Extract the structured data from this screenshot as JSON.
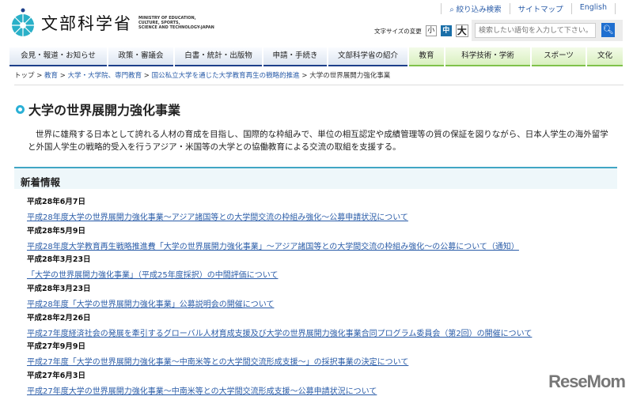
{
  "header": {
    "top_links": [
      "絞り込み検索",
      "サイトマップ",
      "English"
    ],
    "logo_name": "文部科学省",
    "logo_en": [
      "MINISTRY OF EDUCATION,",
      "CULTURE, SPORTS,",
      "SCIENCE AND TECHNOLOGY-JAPAN"
    ],
    "font_size_label": "文字サイズの変更",
    "font_sizes": [
      "小",
      "中",
      "大"
    ],
    "search_placeholder": "検索したい語句を入力して下さい。"
  },
  "nav": [
    "会見・報道・お知らせ",
    "政策・審議会",
    "白書・統計・出版物",
    "申請・手続き",
    "文部科学省の紹介",
    "教育",
    "科学技術・学術",
    "スポーツ",
    "文化"
  ],
  "breadcrumb": [
    "トップ",
    "教育",
    "大学・大学院、専門教育",
    "国公私立大学を通じた大学教育再生の戦略的推進",
    "大学の世界展開力強化事業"
  ],
  "page": {
    "title": "大学の世界展開力強化事業",
    "lead": "世界に雄飛する日本として誇れる人材の育成を目指し、国際的な枠組みで、単位の相互認定や成績管理等の質の保証を図りながら、日本人学生の海外留学と外国人学生の戦略的受入を行うアジア・米国等の大学との協働教育による交流の取組を支援する。",
    "news_heading": "新着情報",
    "news": [
      {
        "date": "平成28年6月7日",
        "title": "平成28年度大学の世界展開力強化事業～アジア諸国等との大学間交流の枠組み強化～公募申請状況について"
      },
      {
        "date": "平成28年5月9日",
        "title": "平成28年度大学教育再生戦略推進費「大学の世界展開力強化事業」～アジア諸国等との大学間交流の枠組み強化～の公募について（通知）"
      },
      {
        "date": "平成28年3月23日",
        "title": "「大学の世界展開力強化事業」（平成25年度採択）の中間評価について"
      },
      {
        "date": "平成28年3月23日",
        "title": "平成28年度「大学の世界展開力強化事業」公募説明会の開催について"
      },
      {
        "date": "平成28年2月26日",
        "title": "平成27年度経済社会の発展を牽引するグローバル人材育成支援及び大学の世界展開力強化事業合同プログラム委員会（第2回）の開催について"
      },
      {
        "date": "平成27年9月9日",
        "title": "平成27年度「大学の世界展開力強化事業～中南米等との大学間交流形成支援～」の採択事業の決定について"
      },
      {
        "date": "平成27年6月3日",
        "title": "平成27年度大学の世界展開力強化事業～中南米等との大学間交流形成支援～公募申請状況について"
      }
    ]
  },
  "watermark": "ReseMom"
}
